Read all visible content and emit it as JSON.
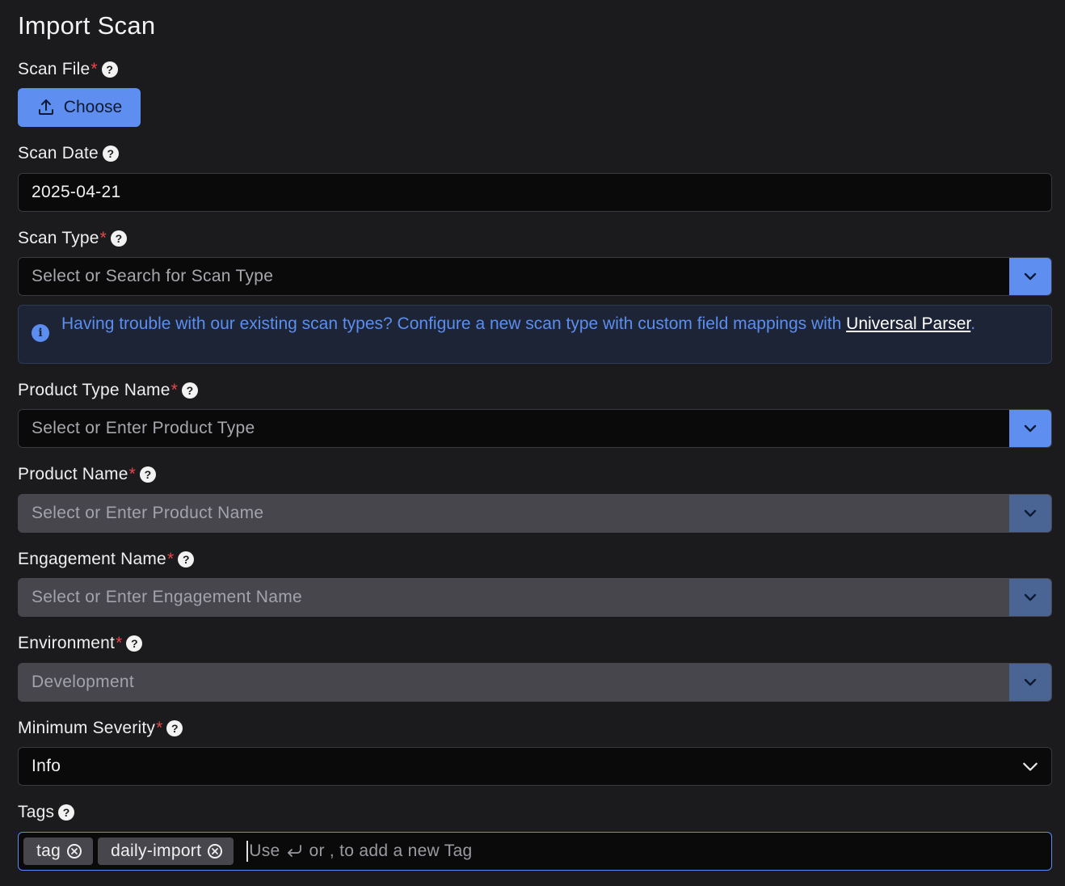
{
  "page": {
    "title": "Import Scan"
  },
  "fields": {
    "scan_file": {
      "label": "Scan File",
      "required": "*",
      "button": "Choose"
    },
    "scan_date": {
      "label": "Scan Date",
      "value": "2025-04-21"
    },
    "scan_type": {
      "label": "Scan Type",
      "required": "*",
      "placeholder": "Select or Search for Scan Type"
    },
    "product_type": {
      "label": "Product Type Name",
      "required": "*",
      "placeholder": "Select or Enter Product Type"
    },
    "product_name": {
      "label": "Product Name",
      "required": "*",
      "placeholder": "Select or Enter Product Name"
    },
    "engagement_name": {
      "label": "Engagement Name",
      "required": "*",
      "placeholder": "Select or Enter Engagement Name"
    },
    "environment": {
      "label": "Environment",
      "required": "*",
      "value": "Development"
    },
    "minimum_severity": {
      "label": "Minimum Severity",
      "required": "*",
      "value": "Info"
    },
    "tags": {
      "label": "Tags",
      "items": [
        "tag",
        "daily-import"
      ],
      "input_hint_pre": "Use",
      "input_hint_post": "or , to add a new Tag"
    }
  },
  "info_banner": {
    "text": "Having trouble with our existing scan types? Configure a new scan type with custom field mappings with",
    "link_text": "Universal Parser",
    "suffix": "."
  },
  "help_glyph": "?",
  "info_glyph": "i",
  "icons": {
    "upload": "upload-icon",
    "help": "help-circle-icon",
    "chevron": "chevron-down-icon",
    "info": "info-icon",
    "remove": "close-circle-icon",
    "enter": "enter-key-icon"
  },
  "colors": {
    "background": "#1b1b1d",
    "accent": "#5d8ef0",
    "required": "#e5484d",
    "disabled_field": "#46464c"
  }
}
